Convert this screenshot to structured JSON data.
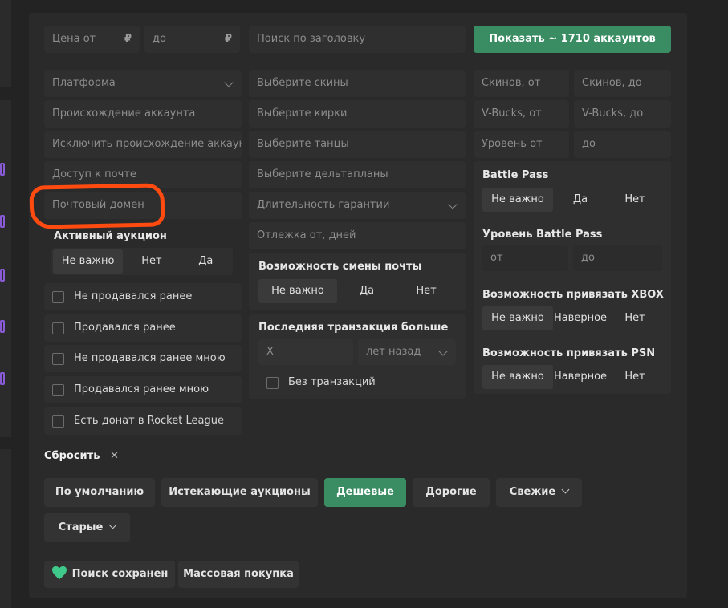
{
  "price": {
    "from_placeholder": "Цена от",
    "to_placeholder": "до",
    "currency": "₽"
  },
  "search": {
    "placeholder": "Поиск по заголовку"
  },
  "show_button": "Показать ~ 1710 аккаунтов",
  "col1": {
    "platform": "Платформа",
    "origin": "Происхождение аккаунта",
    "exclude_origin": "Исключить происхождение аккаунт",
    "mail_access": "Доступ к почте",
    "mail_domain": "Почтовый домен"
  },
  "col2": {
    "skins": "Выберите скины",
    "pickaxes": "Выберите кирки",
    "dances": "Выберите танцы",
    "gliders": "Выберите дельтапланы",
    "warranty": "Длительность гарантии",
    "rest_days": "Отлежка от, дней"
  },
  "col3": {
    "skins_from": "Скинов, от",
    "skins_to": "Скинов, до",
    "vbucks_from": "V-Bucks, от",
    "vbucks_to": "V-Bucks, до",
    "level_from": "Уровень от",
    "level_to": "до"
  },
  "auction": {
    "title": "Активный аукцион",
    "options": [
      "Не важно",
      "Нет",
      "Да"
    ]
  },
  "checkboxes": [
    "Не продавался ранее",
    "Продавался ранее",
    "Не продавался ранее мною",
    "Продавался ранее мною",
    "Есть донат в Rocket League"
  ],
  "email_change": {
    "title": "Возможность смены почты",
    "options": [
      "Не важно",
      "Да",
      "Нет"
    ]
  },
  "last_tx": {
    "title": "Последняя транзакция больше",
    "x_placeholder": "X",
    "unit": "лет назад",
    "no_tx": "Без транзакций"
  },
  "battle_pass": {
    "title": "Battle Pass",
    "options": [
      "Не важно",
      "Да",
      "Нет"
    ]
  },
  "bp_level": {
    "title": "Уровень Battle Pass",
    "from": "от",
    "to": "до"
  },
  "xbox": {
    "title": "Возможность привязать XBOX",
    "options": [
      "Не важно",
      "Наверное",
      "Нет"
    ]
  },
  "psn": {
    "title": "Возможность привязать PSN",
    "options": [
      "Не важно",
      "Наверное",
      "Нет"
    ]
  },
  "reset": {
    "label": "Сбросить",
    "icon": "✕"
  },
  "sort": {
    "default": "По умолчанию",
    "expiring": "Истекающие аукционы",
    "cheap": "Дешевые",
    "expensive": "Дорогие",
    "fresh": "Свежие",
    "old": "Старые"
  },
  "actions": {
    "saved": "Поиск сохранен",
    "bulk": "Массовая покупка"
  },
  "colors": {
    "accent": "#3a8d63",
    "annotation": "#ff4a10",
    "heart": "#3fc98a"
  }
}
